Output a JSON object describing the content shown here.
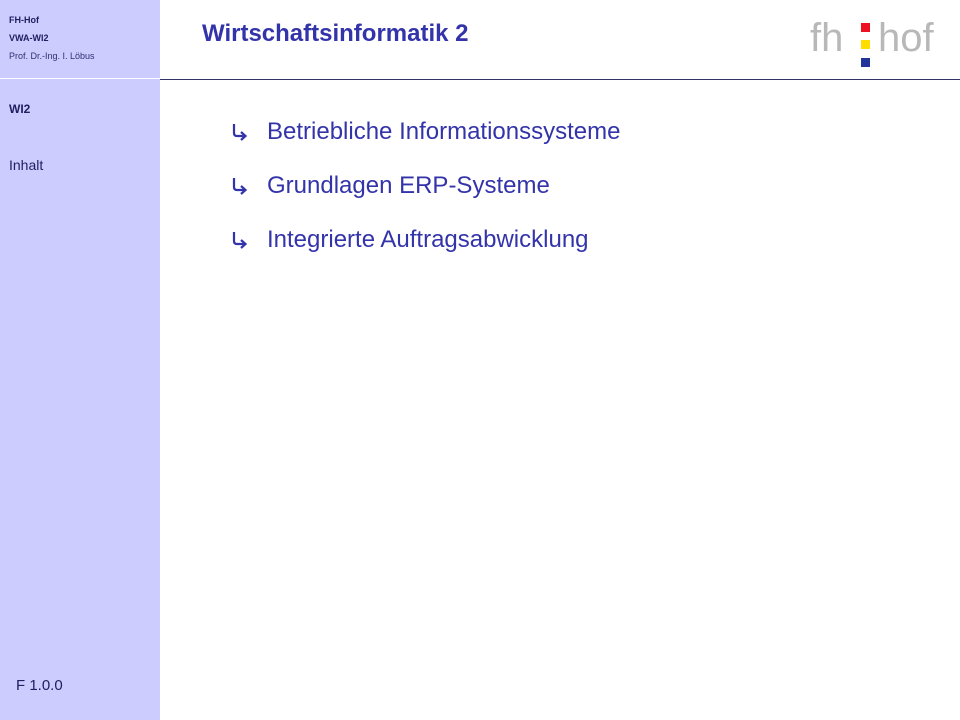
{
  "sidebar": {
    "header": {
      "org": "FH-Hof",
      "course": "VWA-WI2",
      "author": "Prof. Dr.-Ing. I. Löbus"
    },
    "nav": [
      {
        "label": "WI2",
        "active": true
      },
      {
        "label": "Inhalt",
        "active": false
      }
    ],
    "version": "F 1.0.0"
  },
  "slide": {
    "title": "Wirtschaftsinformatik 2",
    "bullets": [
      "Betriebliche Informationssysteme",
      "Grundlagen ERP-Systeme",
      "Integrierte Auftragsabwicklung"
    ]
  },
  "logo": {
    "left_text": "fh",
    "right_text": "hof",
    "colors": {
      "red": "#ee1122",
      "yellow": "#ffdd00",
      "blue": "#223399",
      "text": "#b8b8b8"
    }
  },
  "theme": {
    "sidebar_bg": "#ccccff",
    "title_color": "#3333aa",
    "bullet_icon": "arrow-turn-right-icon"
  }
}
